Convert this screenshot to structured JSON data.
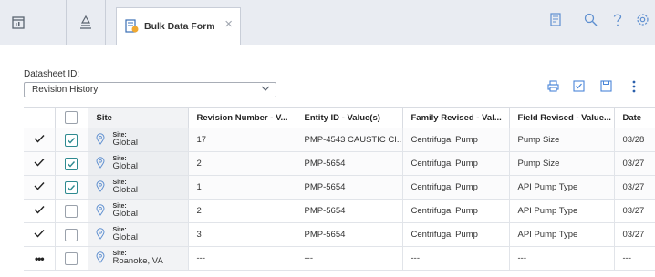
{
  "tabs": {
    "doc_tab_label": "Bulk Data Form"
  },
  "datasheet": {
    "label": "Datasheet ID:",
    "selected": "Revision History"
  },
  "table": {
    "headers": [
      "Site",
      "Revision Number - V...",
      "Entity ID - Value(s)",
      "Family Revised - Val...",
      "Field Revised - Value...",
      "Date"
    ],
    "site_key": "Site:",
    "rows": [
      {
        "checked": true,
        "row_marker": "tick",
        "site": "Global",
        "revision": "17",
        "entity": "PMP-4543 CAUSTIC CI...",
        "family": "Centrifugal Pump",
        "field": "Pump Size",
        "date": "03/28"
      },
      {
        "checked": true,
        "row_marker": "tick",
        "site": "Global",
        "revision": "2",
        "entity": "PMP-5654",
        "family": "Centrifugal Pump",
        "field": "Pump Size",
        "date": "03/27"
      },
      {
        "checked": true,
        "row_marker": "tick",
        "site": "Global",
        "revision": "1",
        "entity": "PMP-5654",
        "family": "Centrifugal Pump",
        "field": "API Pump Type",
        "date": "03/27"
      },
      {
        "checked": false,
        "row_marker": "tick",
        "site": "Global",
        "revision": "2",
        "entity": "PMP-5654",
        "family": "Centrifugal Pump",
        "field": "API Pump Type",
        "date": "03/27"
      },
      {
        "checked": false,
        "row_marker": "tick",
        "site": "Global",
        "revision": "3",
        "entity": "PMP-5654",
        "family": "Centrifugal Pump",
        "field": "API Pump Type",
        "date": "03/27"
      },
      {
        "checked": false,
        "row_marker": "dots",
        "site": "Roanoke, VA",
        "revision": "---",
        "entity": "---",
        "family": "---",
        "field": "---",
        "date": "---"
      }
    ]
  },
  "icons": {
    "tab1": "dashboard-icon",
    "tab2": "hierarchy-icon",
    "doc": "bulk-data-form-icon",
    "toolbar": [
      "notes-icon",
      "search-icon",
      "help-icon",
      "settings-icon"
    ],
    "actions": [
      "print-icon",
      "check-icon",
      "save-icon",
      "more-icon"
    ]
  },
  "colors": {
    "accent": "#4a86d8",
    "check_teal": "#2e8a90",
    "tabbar_bg": "#e9ecf2"
  }
}
